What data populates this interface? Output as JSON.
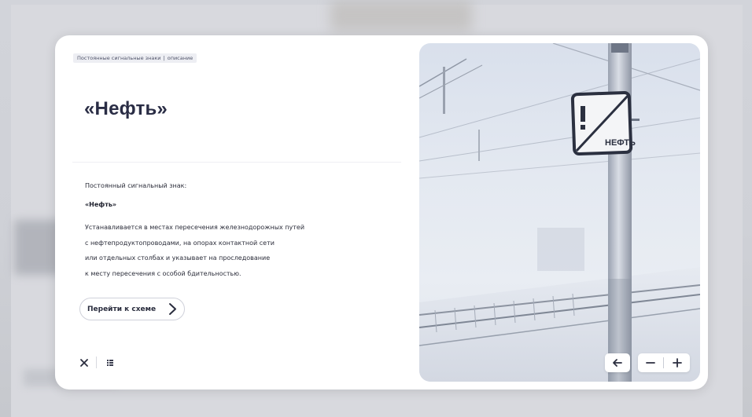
{
  "breadcrumb": {
    "section": "Постоянные сигнальные знаки",
    "separator": "|",
    "page": "описание"
  },
  "title": "«Нефть»",
  "description": {
    "label": "Постоянный сигнальный знак:",
    "name": "«Нефть»",
    "lines": [
      "Устанавливается в местах пересечения железнодорожных путей",
      "с нефтепродуктопроводами, на опорах контактной сети",
      "или отдельных столбах и указывает на проследование",
      "к месту пересечения с особой бдительностью."
    ]
  },
  "scheme_button": {
    "label": "Перейти к схеме",
    "icon": "chevron-right-icon"
  },
  "controls": {
    "close_icon": "close-icon",
    "grid_icon": "grid-icon"
  },
  "image": {
    "sign_text": "НЕФТЬ",
    "back_icon": "arrow-left-icon",
    "zoom_out_icon": "minus-icon",
    "zoom_in_icon": "plus-icon"
  },
  "colors": {
    "title": "#2a2d45",
    "sign_frame": "#2b3040",
    "background": "#c9ccd3"
  }
}
